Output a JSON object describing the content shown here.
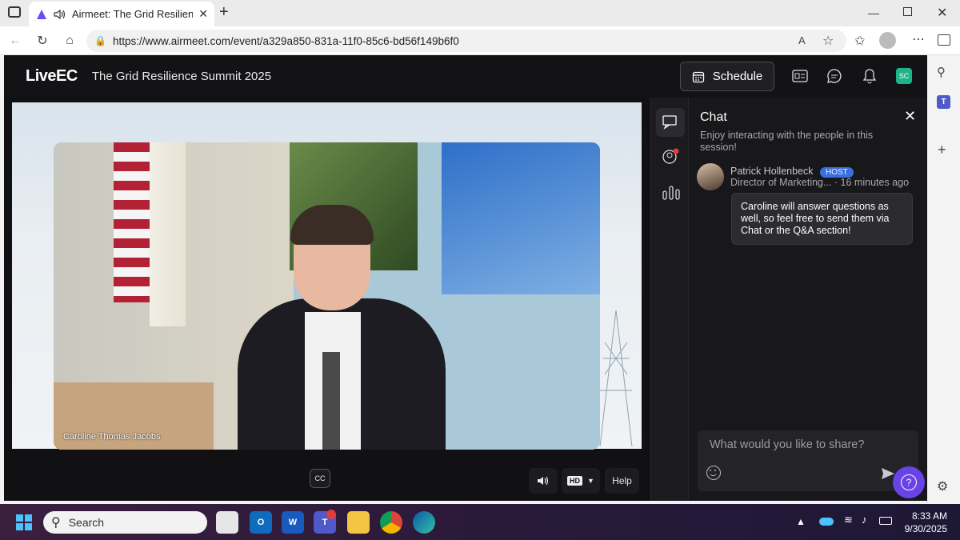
{
  "browser": {
    "tab_title": "Airmeet: The Grid Resilience",
    "url": "https://www.airmeet.com/event/a329a850-831a-11f0-85c6-bd56f149b6f0"
  },
  "app": {
    "logo": "LiveEC",
    "event_title": "The Grid Resilience Summit 2025",
    "schedule_label": "Schedule",
    "avatar_initials": "SC"
  },
  "video": {
    "speaker_name": "Caroline Thomas Jacobs"
  },
  "controls": {
    "cc_label": "CC",
    "quality_label": "HD",
    "help_label": "Help"
  },
  "chat": {
    "title": "Chat",
    "subtitle": "Enjoy interacting with the people in this session!",
    "message": {
      "author": "Patrick Hollenbeck",
      "badge": "HOST",
      "role": "Director of Marketing...",
      "time": "· 16 minutes ago",
      "text": "Caroline will answer questions as well, so feel free to send them via Chat or the Q&A section!"
    },
    "input_placeholder": "What would you like to share?"
  },
  "taskbar": {
    "search_label": "Search",
    "time": "8:33 AM",
    "date": "9/30/2025"
  },
  "colors": {
    "accent_host": "#3b6fe0",
    "help_button": "#6a43e6",
    "avatar": "#1fb38a"
  }
}
